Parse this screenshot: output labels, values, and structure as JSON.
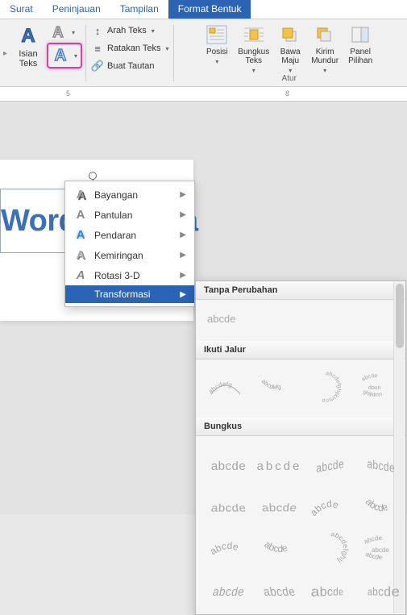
{
  "tabs": [
    {
      "label": "Surat"
    },
    {
      "label": "Peninjauan"
    },
    {
      "label": "Tampilan"
    },
    {
      "label": "Format Bentuk"
    }
  ],
  "ribbon": {
    "text_styles_label": "Isian\nTeks",
    "mid": {
      "arah_teks": "Arah Teks",
      "ratakan_teks": "Ratakan Teks",
      "buat_tautan": "Buat Tautan"
    },
    "arrange": {
      "posisi": "Posisi",
      "bungkus": "Bungkus\nTeks",
      "bawa_maju": "Bawa\nMaju",
      "kirim_mundur": "Kirim\nMundur",
      "panel_pilihan": "Panel\nPilihan",
      "group_label": "Atur"
    }
  },
  "ruler": {
    "n5": "5",
    "n8": "8"
  },
  "wordart_text": "WordArt Saya",
  "effects_menu": [
    {
      "label": "Bayangan",
      "icon": "shadow"
    },
    {
      "label": "Pantulan",
      "icon": "refl"
    },
    {
      "label": "Pendaran",
      "icon": "glow"
    },
    {
      "label": "Kemiringan",
      "icon": "bevel"
    },
    {
      "label": "Rotasi 3-D",
      "icon": "3d"
    },
    {
      "label": "Transformasi",
      "icon": "trans"
    }
  ],
  "gallery": {
    "no_change": "Tanpa Perubahan",
    "sample": "abcde",
    "follow_path": "Ikuti Jalur",
    "wrap": "Bungkus",
    "wrap_sample": "abcde"
  }
}
